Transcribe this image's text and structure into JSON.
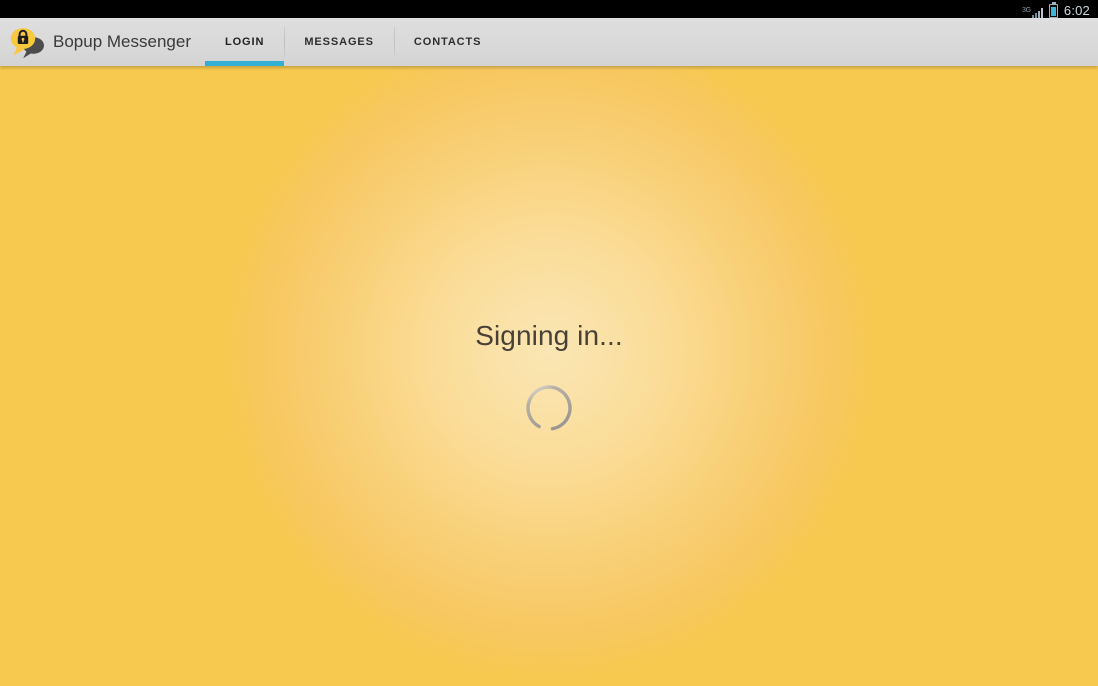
{
  "status_bar": {
    "network_type": "3G",
    "signal_icon": "signal-bars-icon",
    "battery_icon": "battery-icon",
    "time": "6:02"
  },
  "action_bar": {
    "logo_icon": "bopup-lock-speech-bubble-logo",
    "app_title": "Bopup Messenger",
    "tabs": [
      {
        "label": "LOGIN",
        "selected": true
      },
      {
        "label": "MESSAGES",
        "selected": false
      },
      {
        "label": "CONTACTS",
        "selected": false
      }
    ]
  },
  "content": {
    "status_message": "Signing in...",
    "spinner_icon": "loading-spinner-icon"
  },
  "colors": {
    "accent_blue": "#33afd4",
    "background_yellow": "#f7c948",
    "background_center": "#fae6b4",
    "action_bar": "#dcdcdc",
    "logo_yellow": "#f9c83c",
    "logo_dark": "#4a4a4a"
  }
}
